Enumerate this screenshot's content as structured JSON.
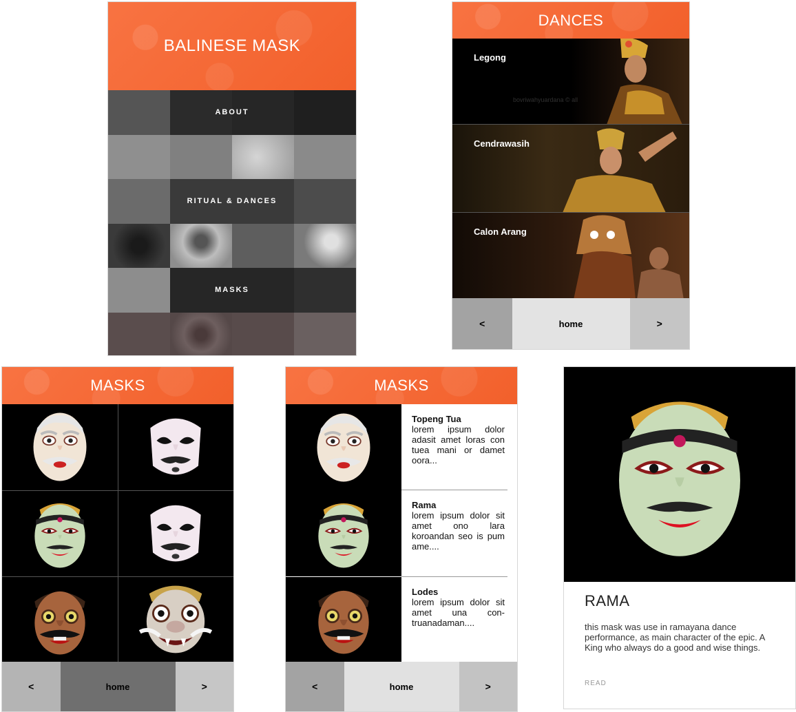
{
  "home_screen": {
    "title": "BALINESE MASK",
    "menu": [
      {
        "label": "ABOUT"
      },
      {
        "label": "RITUAL & DANCES"
      },
      {
        "label": "MASKS"
      }
    ]
  },
  "dances_screen": {
    "title": "DANCES",
    "items": [
      {
        "label": "Legong",
        "watermark": "bovriwahyuardana © all"
      },
      {
        "label": "Cendrawasih"
      },
      {
        "label": "Calon Arang"
      }
    ],
    "nav": {
      "prev": "<",
      "home": "home",
      "next": ">"
    }
  },
  "masks_grid_screen": {
    "title": "MASKS",
    "nav": {
      "prev": "<",
      "home": "home",
      "next": ">"
    }
  },
  "masks_list_screen": {
    "title": "MASKS",
    "items": [
      {
        "title": "Topeng Tua",
        "desc": "lorem ipsum dolor adasit amet loras con tuea mani or damet oora..."
      },
      {
        "title": "Rama",
        "desc": "lorem ipsum dolor sit amet ono lara koroandan seo is pum ame...."
      },
      {
        "title": "Lodes",
        "desc": "lorem ipsum dolor sit amet una con-truanadaman...."
      }
    ],
    "nav": {
      "prev": "<",
      "home": "home",
      "next": ">"
    }
  },
  "detail_screen": {
    "title": "RAMA",
    "description": "this mask was use in ramayana dance performance, as main character of the epic. A King who always do a good and wise things.",
    "read_label": "READ"
  },
  "colors": {
    "header_orange": "#f56a36",
    "nav_dark": "#9a9a9a",
    "nav_light": "#e2e2e2",
    "nav_mid": "#c4c4c4"
  }
}
